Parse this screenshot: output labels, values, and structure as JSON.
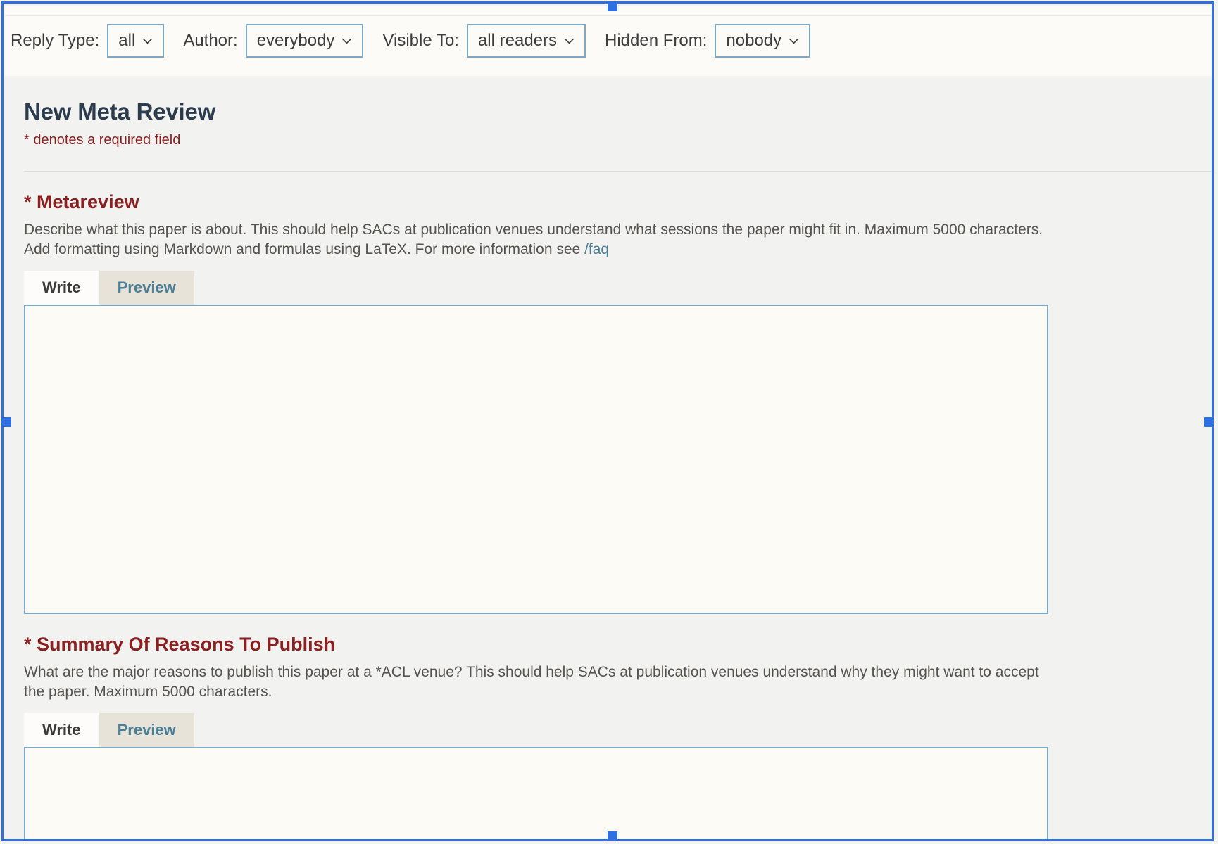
{
  "filter_bar": {
    "filters": [
      {
        "label": "Reply Type:",
        "value": "all",
        "name": "reply-type"
      },
      {
        "label": "Author:",
        "value": "everybody",
        "name": "author"
      },
      {
        "label": "Visible To:",
        "value": "all readers",
        "name": "visible-to"
      },
      {
        "label": "Hidden From:",
        "value": "nobody",
        "name": "hidden-from"
      }
    ]
  },
  "page": {
    "title": "New Meta Review",
    "required_note": "* denotes a required field"
  },
  "fields": [
    {
      "label": "* Metareview",
      "description": "Describe what this paper is about. This should help SACs at publication venues understand what sessions the paper might fit in. Maximum 5000 characters. Add formatting using Markdown and formulas using LaTeX. For more information see ",
      "link_text": "/faq",
      "tab_write": "Write",
      "tab_preview": "Preview",
      "textarea_value": ""
    },
    {
      "label": "* Summary Of Reasons To Publish",
      "description": "What are the major reasons to publish this paper at a *ACL venue? This should help SACs at publication venues understand why they might want to accept the paper. Maximum 5000 characters.",
      "link_text": "",
      "tab_write": "Write",
      "tab_preview": "Preview",
      "textarea_value": ""
    }
  ],
  "colors": {
    "accent_blue": "#2f6fe0",
    "field_label_red": "#8b2020",
    "link_teal": "#4a7f96",
    "input_border": "#7fa8c4",
    "title_navy": "#2b3c4e",
    "panel_bg": "#f2f2f0",
    "filterbar_bg": "#fdfbf7"
  }
}
